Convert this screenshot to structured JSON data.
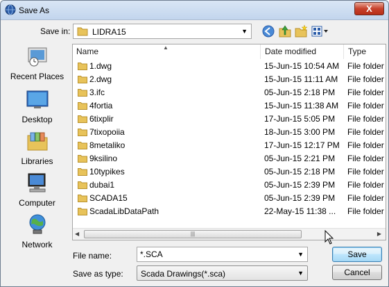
{
  "window": {
    "title": "Save As",
    "close_label": "X"
  },
  "savein": {
    "label": "Save in:",
    "value": "LIDRA15"
  },
  "toolbar": {
    "back_icon": "back-arrow-icon",
    "up_icon": "up-folder-icon",
    "newfolder_icon": "new-folder-icon",
    "views_icon": "views-menu-icon"
  },
  "places": [
    {
      "label": "Recent Places",
      "icon": "recent-places-icon"
    },
    {
      "label": "Desktop",
      "icon": "desktop-icon"
    },
    {
      "label": "Libraries",
      "icon": "libraries-icon"
    },
    {
      "label": "Computer",
      "icon": "computer-icon"
    },
    {
      "label": "Network",
      "icon": "network-icon"
    }
  ],
  "columns": {
    "name": "Name",
    "date": "Date modified",
    "type": "Type"
  },
  "files": [
    {
      "name": "1.dwg",
      "date": "15-Jun-15 10:54 AM",
      "type": "File folder"
    },
    {
      "name": "2.dwg",
      "date": "15-Jun-15 11:11 AM",
      "type": "File folder"
    },
    {
      "name": "3.ifc",
      "date": "05-Jun-15 2:18 PM",
      "type": "File folder"
    },
    {
      "name": "4fortia",
      "date": "15-Jun-15 11:38 AM",
      "type": "File folder"
    },
    {
      "name": "6tixplir",
      "date": "17-Jun-15 5:05 PM",
      "type": "File folder"
    },
    {
      "name": "7tixopoiia",
      "date": "18-Jun-15 3:00 PM",
      "type": "File folder"
    },
    {
      "name": "8metaliko",
      "date": "17-Jun-15 12:17 PM",
      "type": "File folder"
    },
    {
      "name": "9ksilino",
      "date": "05-Jun-15 2:21 PM",
      "type": "File folder"
    },
    {
      "name": "10typikes",
      "date": "05-Jun-15 2:18 PM",
      "type": "File folder"
    },
    {
      "name": "dubai1",
      "date": "05-Jun-15 2:39 PM",
      "type": "File folder"
    },
    {
      "name": "SCADA15",
      "date": "05-Jun-15 2:39 PM",
      "type": "File folder"
    },
    {
      "name": "ScadaLibDataPath",
      "date": "22-May-15 11:38 ...",
      "type": "File folder"
    }
  ],
  "filename": {
    "label": "File name:",
    "value": "*.SCA"
  },
  "savetype": {
    "label": "Save as type:",
    "value": "Scada Drawings(*.sca)"
  },
  "buttons": {
    "save": "Save",
    "cancel": "Cancel"
  },
  "colors": {
    "folder": "#e8c35a",
    "selection_blue": "#3c7fb1"
  }
}
